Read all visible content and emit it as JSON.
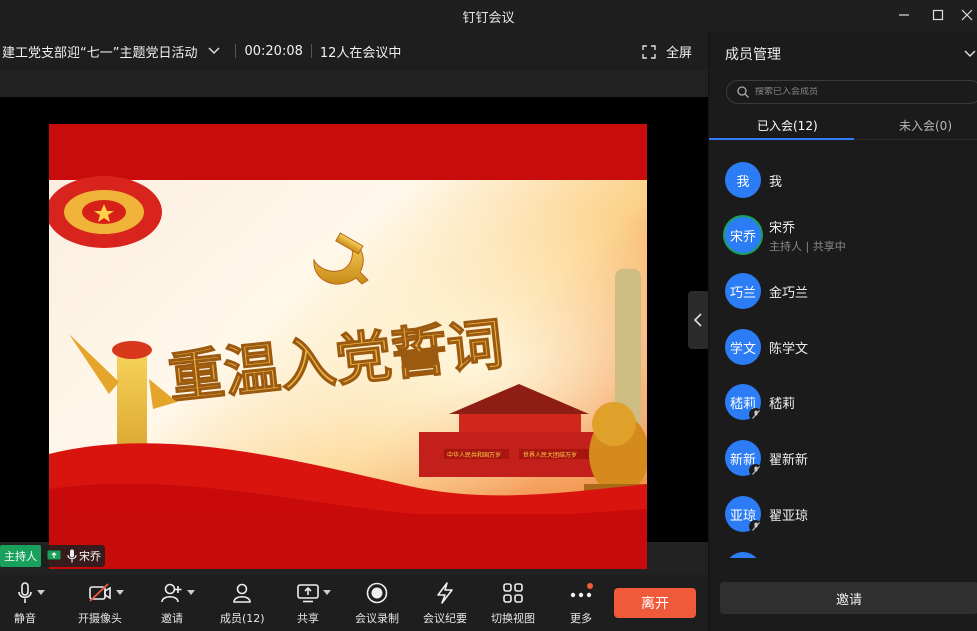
{
  "window": {
    "title": "钉钉会议"
  },
  "meeting": {
    "title": "建工党支部迎“七一”主题党日活动",
    "duration": "00:20:08",
    "attendance": "12人在会议中",
    "fullscreen_label": "全屏"
  },
  "slide": {
    "headline": "重温入党誓词",
    "gate_banner_left": "中华人民共和国万岁",
    "gate_banner_right": "世界人民大团结万岁"
  },
  "presenter": {
    "badge": "主持人",
    "name": "宋乔"
  },
  "toolbar": {
    "mute": "静音",
    "camera": "开摄像头",
    "invite": "邀请",
    "members": "成员(12)",
    "share": "共享",
    "record": "会议录制",
    "minutes": "会议纪要",
    "switch_view": "切换视图",
    "more": "更多",
    "leave": "离开"
  },
  "panel": {
    "title": "成员管理",
    "search_placeholder": "搜索已入会成员",
    "tab_joined": "已入会(12)",
    "tab_not_joined": "未入会(0)",
    "invite_label": "邀请",
    "members": [
      {
        "avatar": "我",
        "name": "我",
        "role": ""
      },
      {
        "avatar": "宋乔",
        "name": "宋乔",
        "role": "主持人 | 共享中"
      },
      {
        "avatar": "巧兰",
        "name": "金巧兰",
        "role": ""
      },
      {
        "avatar": "学文",
        "name": "陈学文",
        "role": ""
      },
      {
        "avatar": "嵇莉",
        "name": "嵇莉",
        "role": ""
      },
      {
        "avatar": "新新",
        "name": "翟新新",
        "role": ""
      },
      {
        "avatar": "亚琼",
        "name": "翟亚琼",
        "role": ""
      }
    ]
  },
  "colors": {
    "accent": "#2f7cf6",
    "leave": "#ef5b3a",
    "host_green": "#19a05a",
    "avatar_blue": "#2c7cf6"
  },
  "icons": [
    "minimize-icon",
    "maximize-icon",
    "close-icon",
    "chevron-down-icon",
    "fullscreen-icon",
    "microphone-icon",
    "camera-off-icon",
    "add-person-icon",
    "people-icon",
    "share-screen-icon",
    "record-icon",
    "minutes-icon",
    "grid-view-icon",
    "more-icon",
    "search-icon",
    "mic-muted-icon"
  ]
}
